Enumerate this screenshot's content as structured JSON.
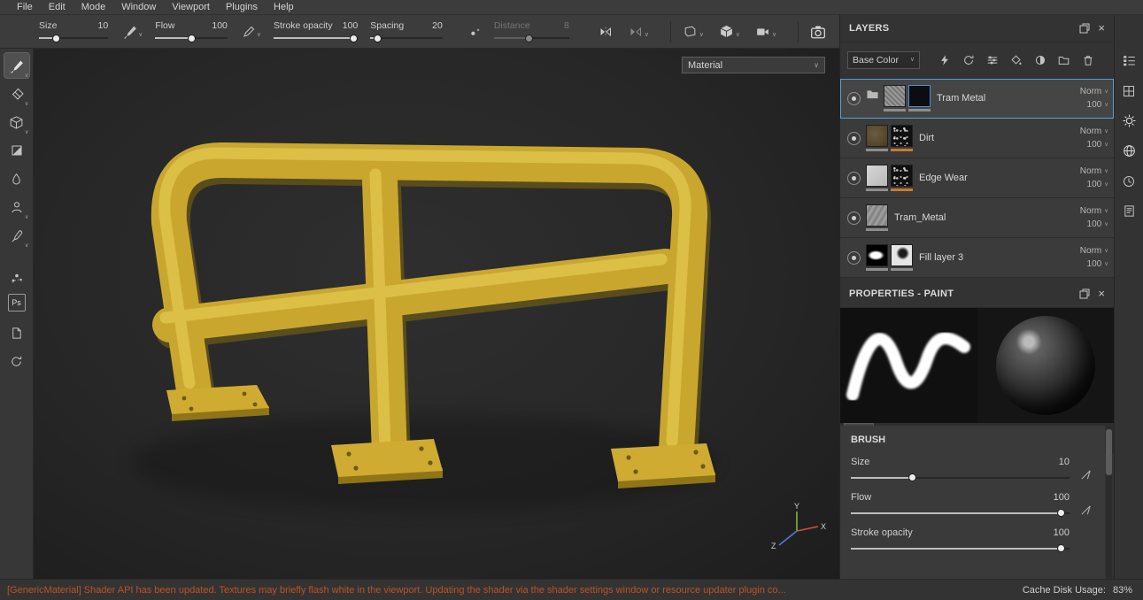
{
  "icons": {
    "chevron_down": "∨",
    "close": "×",
    "ps_badge": "Ps"
  },
  "menubar": {
    "items": [
      "File",
      "Edit",
      "Mode",
      "Window",
      "Viewport",
      "Plugins",
      "Help"
    ]
  },
  "toolbar": {
    "size_label": "Size",
    "size_value": "10",
    "flow_label": "Flow",
    "flow_value": "100",
    "stroke_opacity_label": "Stroke opacity",
    "stroke_opacity_value": "100",
    "spacing_label": "Spacing",
    "spacing_value": "20",
    "distance_label": "Distance",
    "distance_value": "8"
  },
  "viewport": {
    "shading_mode": "Material",
    "axis_x": "X",
    "axis_y": "Y",
    "axis_z": "Z"
  },
  "layers": {
    "title": "LAYERS",
    "channel": "Base Color",
    "rows": [
      {
        "name": "Tram Metal",
        "blend": "Norm",
        "opacity": "100"
      },
      {
        "name": "Dirt",
        "blend": "Norm",
        "opacity": "100"
      },
      {
        "name": "Edge Wear",
        "blend": "Norm",
        "opacity": "100"
      },
      {
        "name": "Tram_Metal",
        "blend": "Norm",
        "opacity": "100"
      },
      {
        "name": "Fill layer 3",
        "blend": "Norm",
        "opacity": "100"
      }
    ]
  },
  "properties": {
    "title": "PROPERTIES - PAINT",
    "section_title": "BRUSH",
    "size_label": "Size",
    "size_value": "10",
    "flow_label": "Flow",
    "flow_value": "100",
    "stroke_opacity_label": "Stroke opacity",
    "stroke_opacity_value": "100"
  },
  "statusbar": {
    "message": "[GenericMaterial] Shader API has been updated. Textures may briefly flash white in the viewport. Updating the shader via the shader settings window or resource updater plugin co...",
    "cache_label": "Cache Disk Usage:",
    "cache_value": "83%"
  }
}
